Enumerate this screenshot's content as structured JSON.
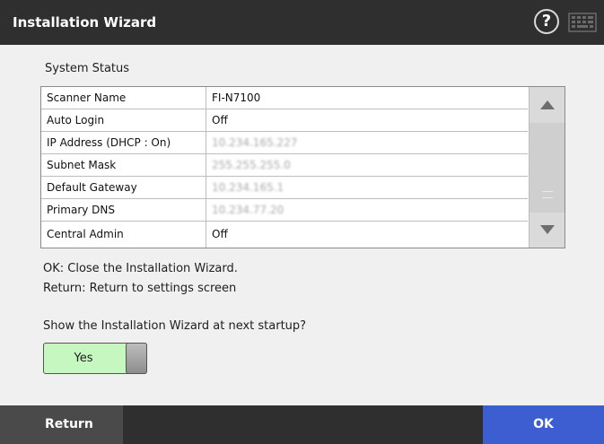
{
  "header": {
    "title": "Installation Wizard",
    "help_icon": "?",
    "keyboard_icon": "keyboard-icon"
  },
  "main": {
    "section_label": "System Status",
    "rows": [
      {
        "name": "Scanner Name",
        "value": "FI-N7100"
      },
      {
        "name": "Auto Login",
        "value": "Off"
      },
      {
        "name": "IP Address (DHCP : On)",
        "value": "10.234.165.227"
      },
      {
        "name": "Subnet Mask",
        "value": "255.255.255.0"
      },
      {
        "name": "Default Gateway",
        "value": "10.234.165.1"
      },
      {
        "name": "Primary DNS",
        "value": "10.234.77.20"
      },
      {
        "name": "Central Admin",
        "value": "Off"
      }
    ],
    "info_line1": "OK: Close the Installation Wizard.",
    "info_line2": "Return: Return to settings screen",
    "question": "Show the Installation Wizard at next startup?",
    "toggle_label": "Yes"
  },
  "footer": {
    "return_label": "Return",
    "ok_label": "OK"
  },
  "colors": {
    "header_bg": "#2f2f2f",
    "ok_bg": "#3c5ed0",
    "toggle_on": "#c6f7c0"
  }
}
